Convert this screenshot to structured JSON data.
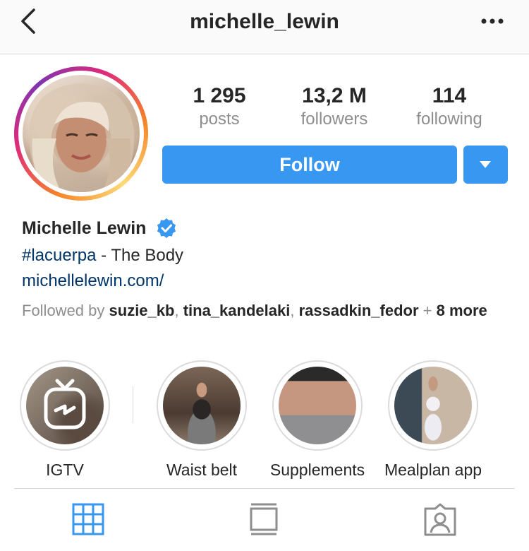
{
  "header": {
    "title": "michelle_lewin"
  },
  "stats": {
    "posts": {
      "value": "1 295",
      "label": "posts"
    },
    "followers": {
      "value": "13,2 M",
      "label": "followers"
    },
    "following": {
      "value": "114",
      "label": "following"
    }
  },
  "actions": {
    "follow_label": "Follow"
  },
  "profile": {
    "name": "Michelle Lewin",
    "bio_hashtag": "#lacuerpa",
    "bio_text": " - The Body",
    "website": "michellelewin.com/",
    "followed_by_prefix": "Followed by ",
    "followed_users": [
      "suzie_kb",
      "tina_kandelaki",
      "rassadkin_fedor"
    ],
    "followed_sep": ", ",
    "followed_more_prefix": " + ",
    "followed_more": "8 more"
  },
  "highlights": [
    {
      "label": "IGTV",
      "icon": "igtv-icon"
    },
    {
      "label": "Waist belt"
    },
    {
      "label": "Supplements"
    },
    {
      "label": "Mealplan app"
    }
  ],
  "tabs": [
    {
      "icon": "grid-icon",
      "active": true
    },
    {
      "icon": "feed-icon",
      "active": false
    },
    {
      "icon": "tagged-icon",
      "active": false
    }
  ],
  "colors": {
    "accent": "#3897f0",
    "link": "#003569",
    "muted": "#8e8e8e"
  }
}
